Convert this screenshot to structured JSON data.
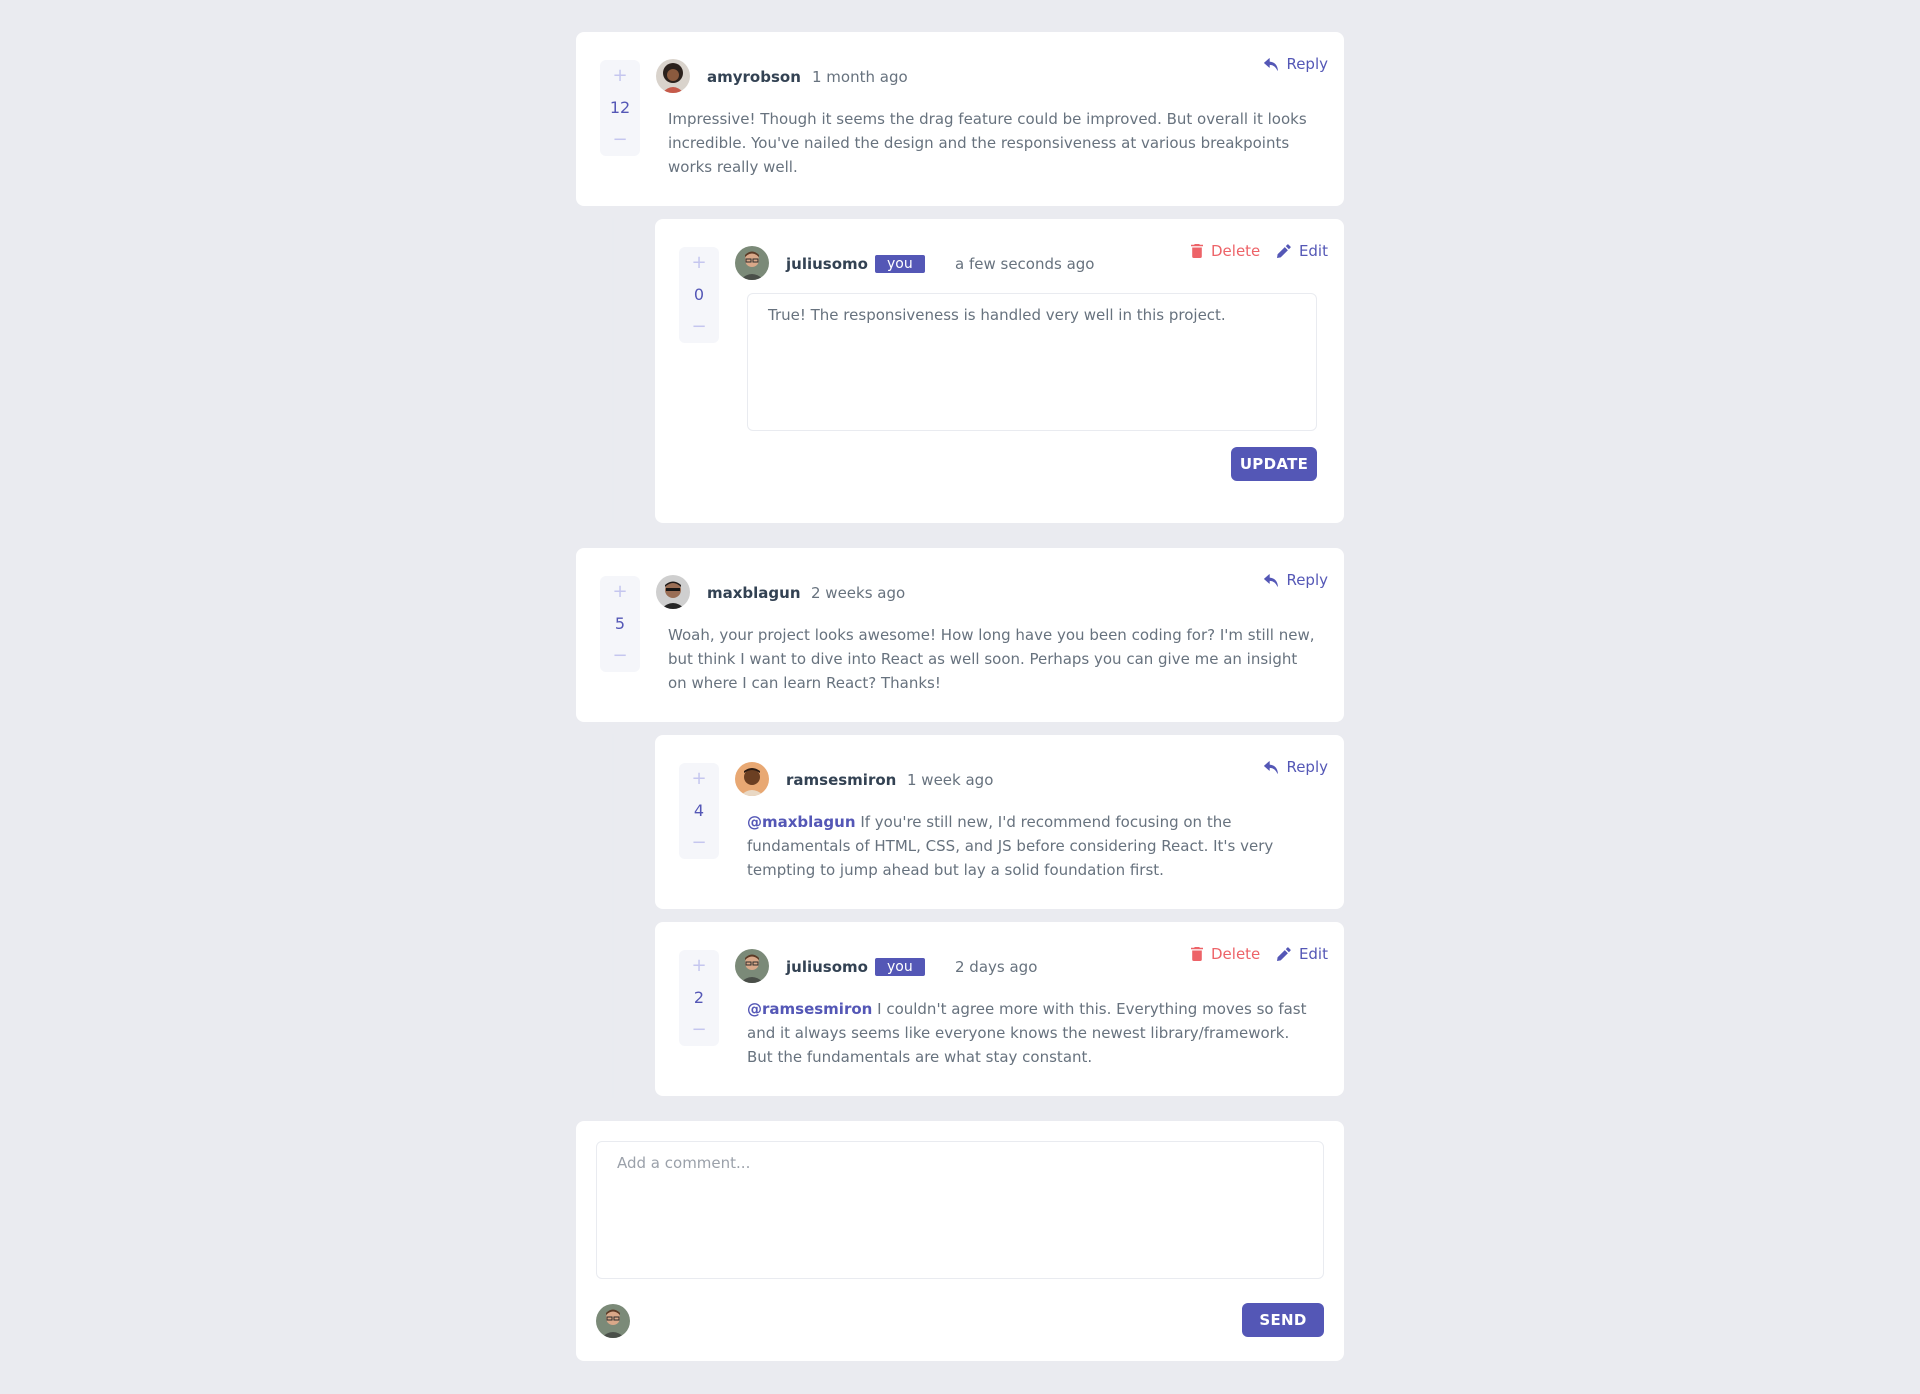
{
  "colors": {
    "background": "#eaebf0",
    "card": "#ffffff",
    "accent": "#5457b6",
    "vote_muted": "#c5c6ef",
    "danger": "#ed6368",
    "name": "#334253",
    "text": "#67727e"
  },
  "labels": {
    "reply": "Reply",
    "delete": "Delete",
    "edit": "Edit",
    "you": "you",
    "update": "UPDATE",
    "send": "SEND",
    "upvote": "+",
    "downvote": "−"
  },
  "icons": {
    "reply": "reply-icon",
    "delete": "trash-icon",
    "edit": "pencil-icon"
  },
  "comments": [
    {
      "username": "amyrobson",
      "time": "1 month ago",
      "score": "12",
      "text": "Impressive! Though it seems the drag feature could be improved. But overall it looks incredible. You've nailed the design and the responsiveness at various breakpoints works really well."
    },
    {
      "username": "maxblagun",
      "time": "2 weeks ago",
      "score": "5",
      "text": "Woah, your project looks awesome! How long have you been coding for? I'm still new, but think I want to dive into React as well soon. Perhaps you can give me an insight on where I can learn React? Thanks!"
    }
  ],
  "replies": [
    {
      "username": "juliusomo",
      "time": "a few seconds ago",
      "score": "0",
      "edit_value": "True! The responsiveness is handled very well in this project."
    },
    {
      "username": "ramsesmiron",
      "time": "1 week ago",
      "score": "4",
      "mention": "@maxblagun",
      "text": "If you're still new, I'd recommend focusing on the fundamentals of HTML, CSS, and JS before considering React. It's very tempting to jump ahead but lay a solid foundation first."
    },
    {
      "username": "juliusomo",
      "time": "2 days ago",
      "score": "2",
      "mention": "@ramsesmiron",
      "text": "I couldn't agree more with this. Everything moves so fast and it always seems like everyone knows the newest library/framework. But the fundamentals are what stay constant."
    }
  ],
  "composer": {
    "placeholder": "Add a comment..."
  }
}
